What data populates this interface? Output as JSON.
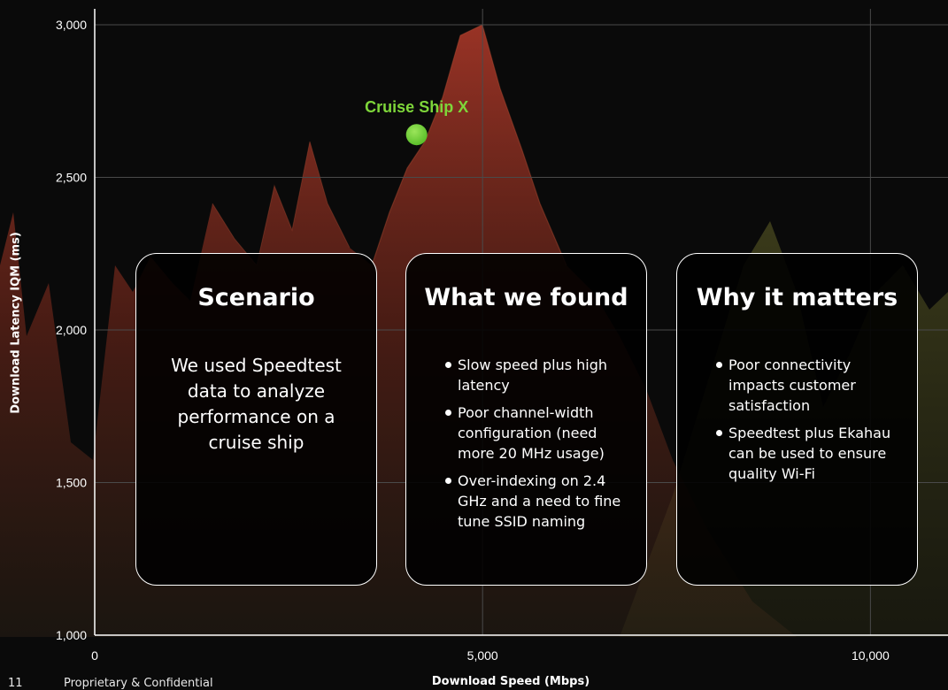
{
  "slide": {
    "page_number": "11",
    "footer_text": "Proprietary & Confidential"
  },
  "chart_data": {
    "type": "scatter",
    "xlabel": "Download Speed (Mbps)",
    "ylabel": "Download Latency IQM (ms)",
    "xlim": [
      0,
      11000
    ],
    "ylim": [
      1000,
      3000
    ],
    "x_ticks": [
      0,
      5000,
      10000
    ],
    "x_tick_labels": [
      "0",
      "5,000",
      "10,000"
    ],
    "y_ticks": [
      1000,
      1500,
      2000,
      2500,
      3000
    ],
    "y_tick_labels": [
      "1,000",
      "1,500",
      "2,000",
      "2,500",
      "3,000"
    ],
    "grid": true,
    "points": [
      {
        "label": "Cruise Ship X",
        "x": 4150,
        "y": 2640
      }
    ],
    "colors": {
      "point": "#5bbf2a",
      "label": "#7ed63a",
      "grid": "#4a4a4a",
      "axis": "#ffffff"
    }
  },
  "cards": [
    {
      "title": "Scenario",
      "body": "We used Speedtest data to analyze performance on a cruise ship"
    },
    {
      "title": "What we found",
      "bullets": [
        "Slow speed plus high latency",
        "Poor channel-width configuration (need more 20 MHz usage)",
        "Over-indexing on 2.4 GHz and a need to fine tune SSID naming"
      ]
    },
    {
      "title": "Why it matters",
      "bullets": [
        "Poor connectivity impacts customer satisfaction",
        "Speedtest plus Ekahau can be used to ensure quality Wi-Fi"
      ]
    }
  ]
}
